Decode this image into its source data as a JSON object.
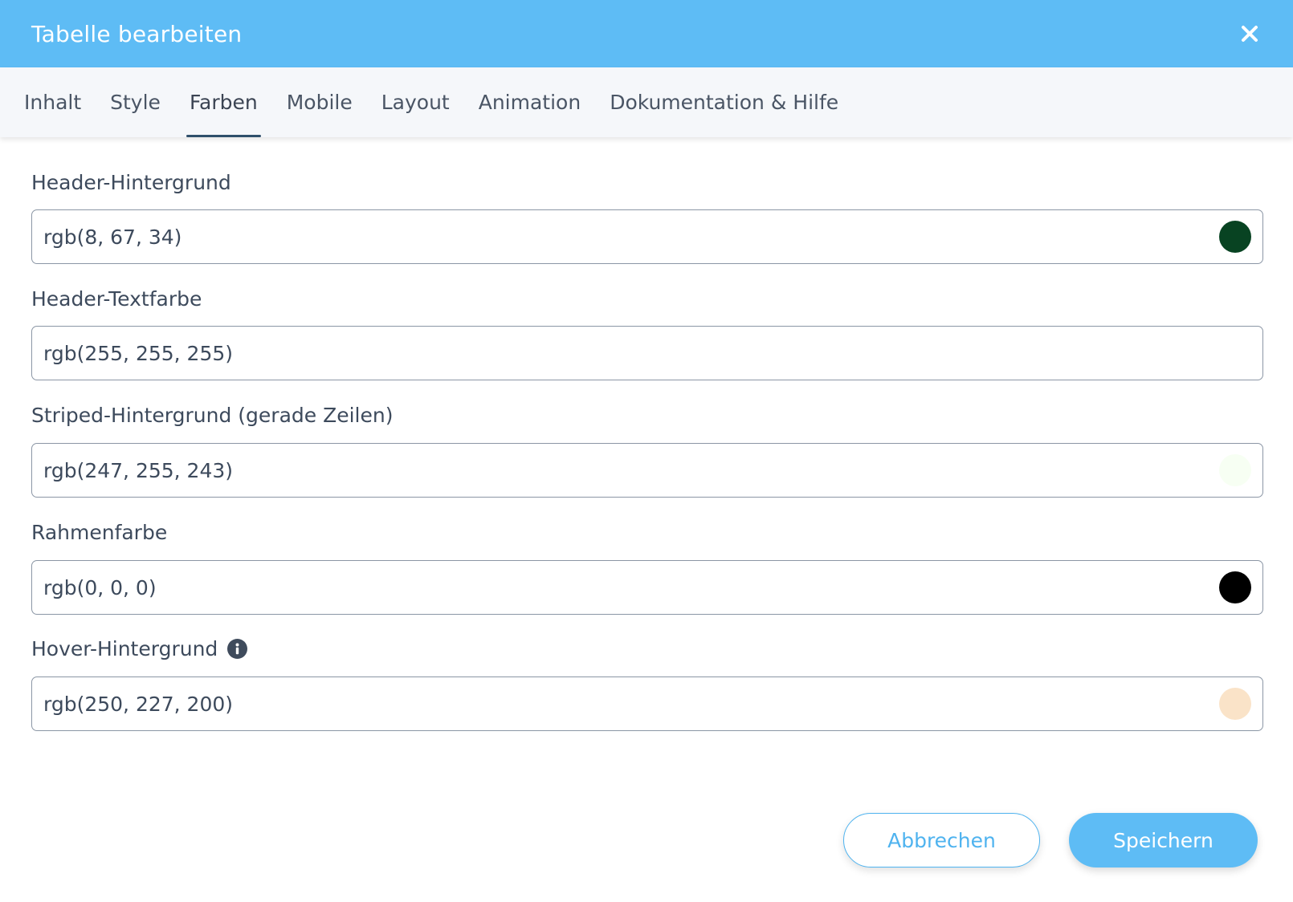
{
  "dialog": {
    "title": "Tabelle bearbeiten",
    "close_icon": "close-icon"
  },
  "tabs": [
    {
      "label": "Inhalt",
      "active": false
    },
    {
      "label": "Style",
      "active": false
    },
    {
      "label": "Farben",
      "active": true
    },
    {
      "label": "Mobile",
      "active": false
    },
    {
      "label": "Layout",
      "active": false
    },
    {
      "label": "Animation",
      "active": false
    },
    {
      "label": "Dokumentation & Hilfe",
      "active": false
    }
  ],
  "fields": [
    {
      "label": "Header-Hintergrund",
      "value": "rgb(8, 67, 34)",
      "swatch_color": "#084322"
    },
    {
      "label": "Header-Textfarbe",
      "value": "rgb(255, 255, 255)",
      "swatch_color": "#ffffff"
    },
    {
      "label": "Striped-Hintergrund (gerade Zeilen)",
      "value": "rgb(247, 255, 243)",
      "swatch_color": "#f7fff3"
    },
    {
      "label": "Rahmenfarbe",
      "value": "rgb(0, 0, 0)",
      "swatch_color": "#000000"
    },
    {
      "label": "Hover-Hintergrund",
      "value": "rgb(250, 227, 200)",
      "swatch_color": "#fae3c8",
      "has_info_icon": true
    }
  ],
  "buttons": {
    "cancel_label": "Abbrechen",
    "save_label": "Speichern"
  },
  "colors": {
    "accent": "#5ebcf5",
    "tab_underline": "#2f4f6b",
    "text": "#3d4a5c"
  }
}
